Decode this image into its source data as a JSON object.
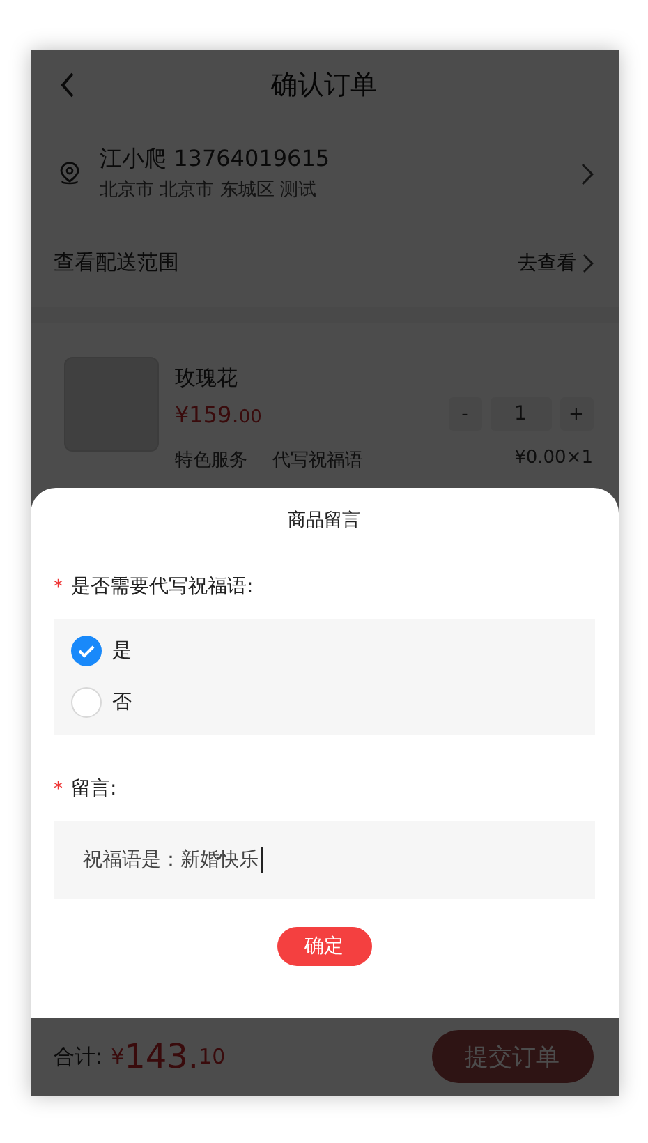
{
  "header": {
    "title": "确认订单"
  },
  "address": {
    "name_phone": "江小爬 13764019615",
    "detail": "北京市 北京市 东城区 测试"
  },
  "delivery": {
    "label": "查看配送范围",
    "link": "去查看"
  },
  "product": {
    "name": "玫瑰花",
    "price_int": "¥159.",
    "price_dec": "00",
    "minus": "-",
    "quantity": "1",
    "plus": "+",
    "service_label": "特色服务",
    "service_name": "代写祝福语",
    "service_price": "¥0.00×1"
  },
  "footer": {
    "total_label": "合计:",
    "currency": "¥",
    "total_int": "143.",
    "total_dec": "10",
    "submit": "提交订单"
  },
  "sheet": {
    "title": "商品留言",
    "question": {
      "mark": "*",
      "label": "是否需要代写祝福语:"
    },
    "options": [
      {
        "label": "是",
        "selected": true
      },
      {
        "label": "否",
        "selected": false
      }
    ],
    "message": {
      "mark": "*",
      "label": "留言:",
      "value": "祝福语是：新婚快乐"
    },
    "confirm": "确定"
  }
}
